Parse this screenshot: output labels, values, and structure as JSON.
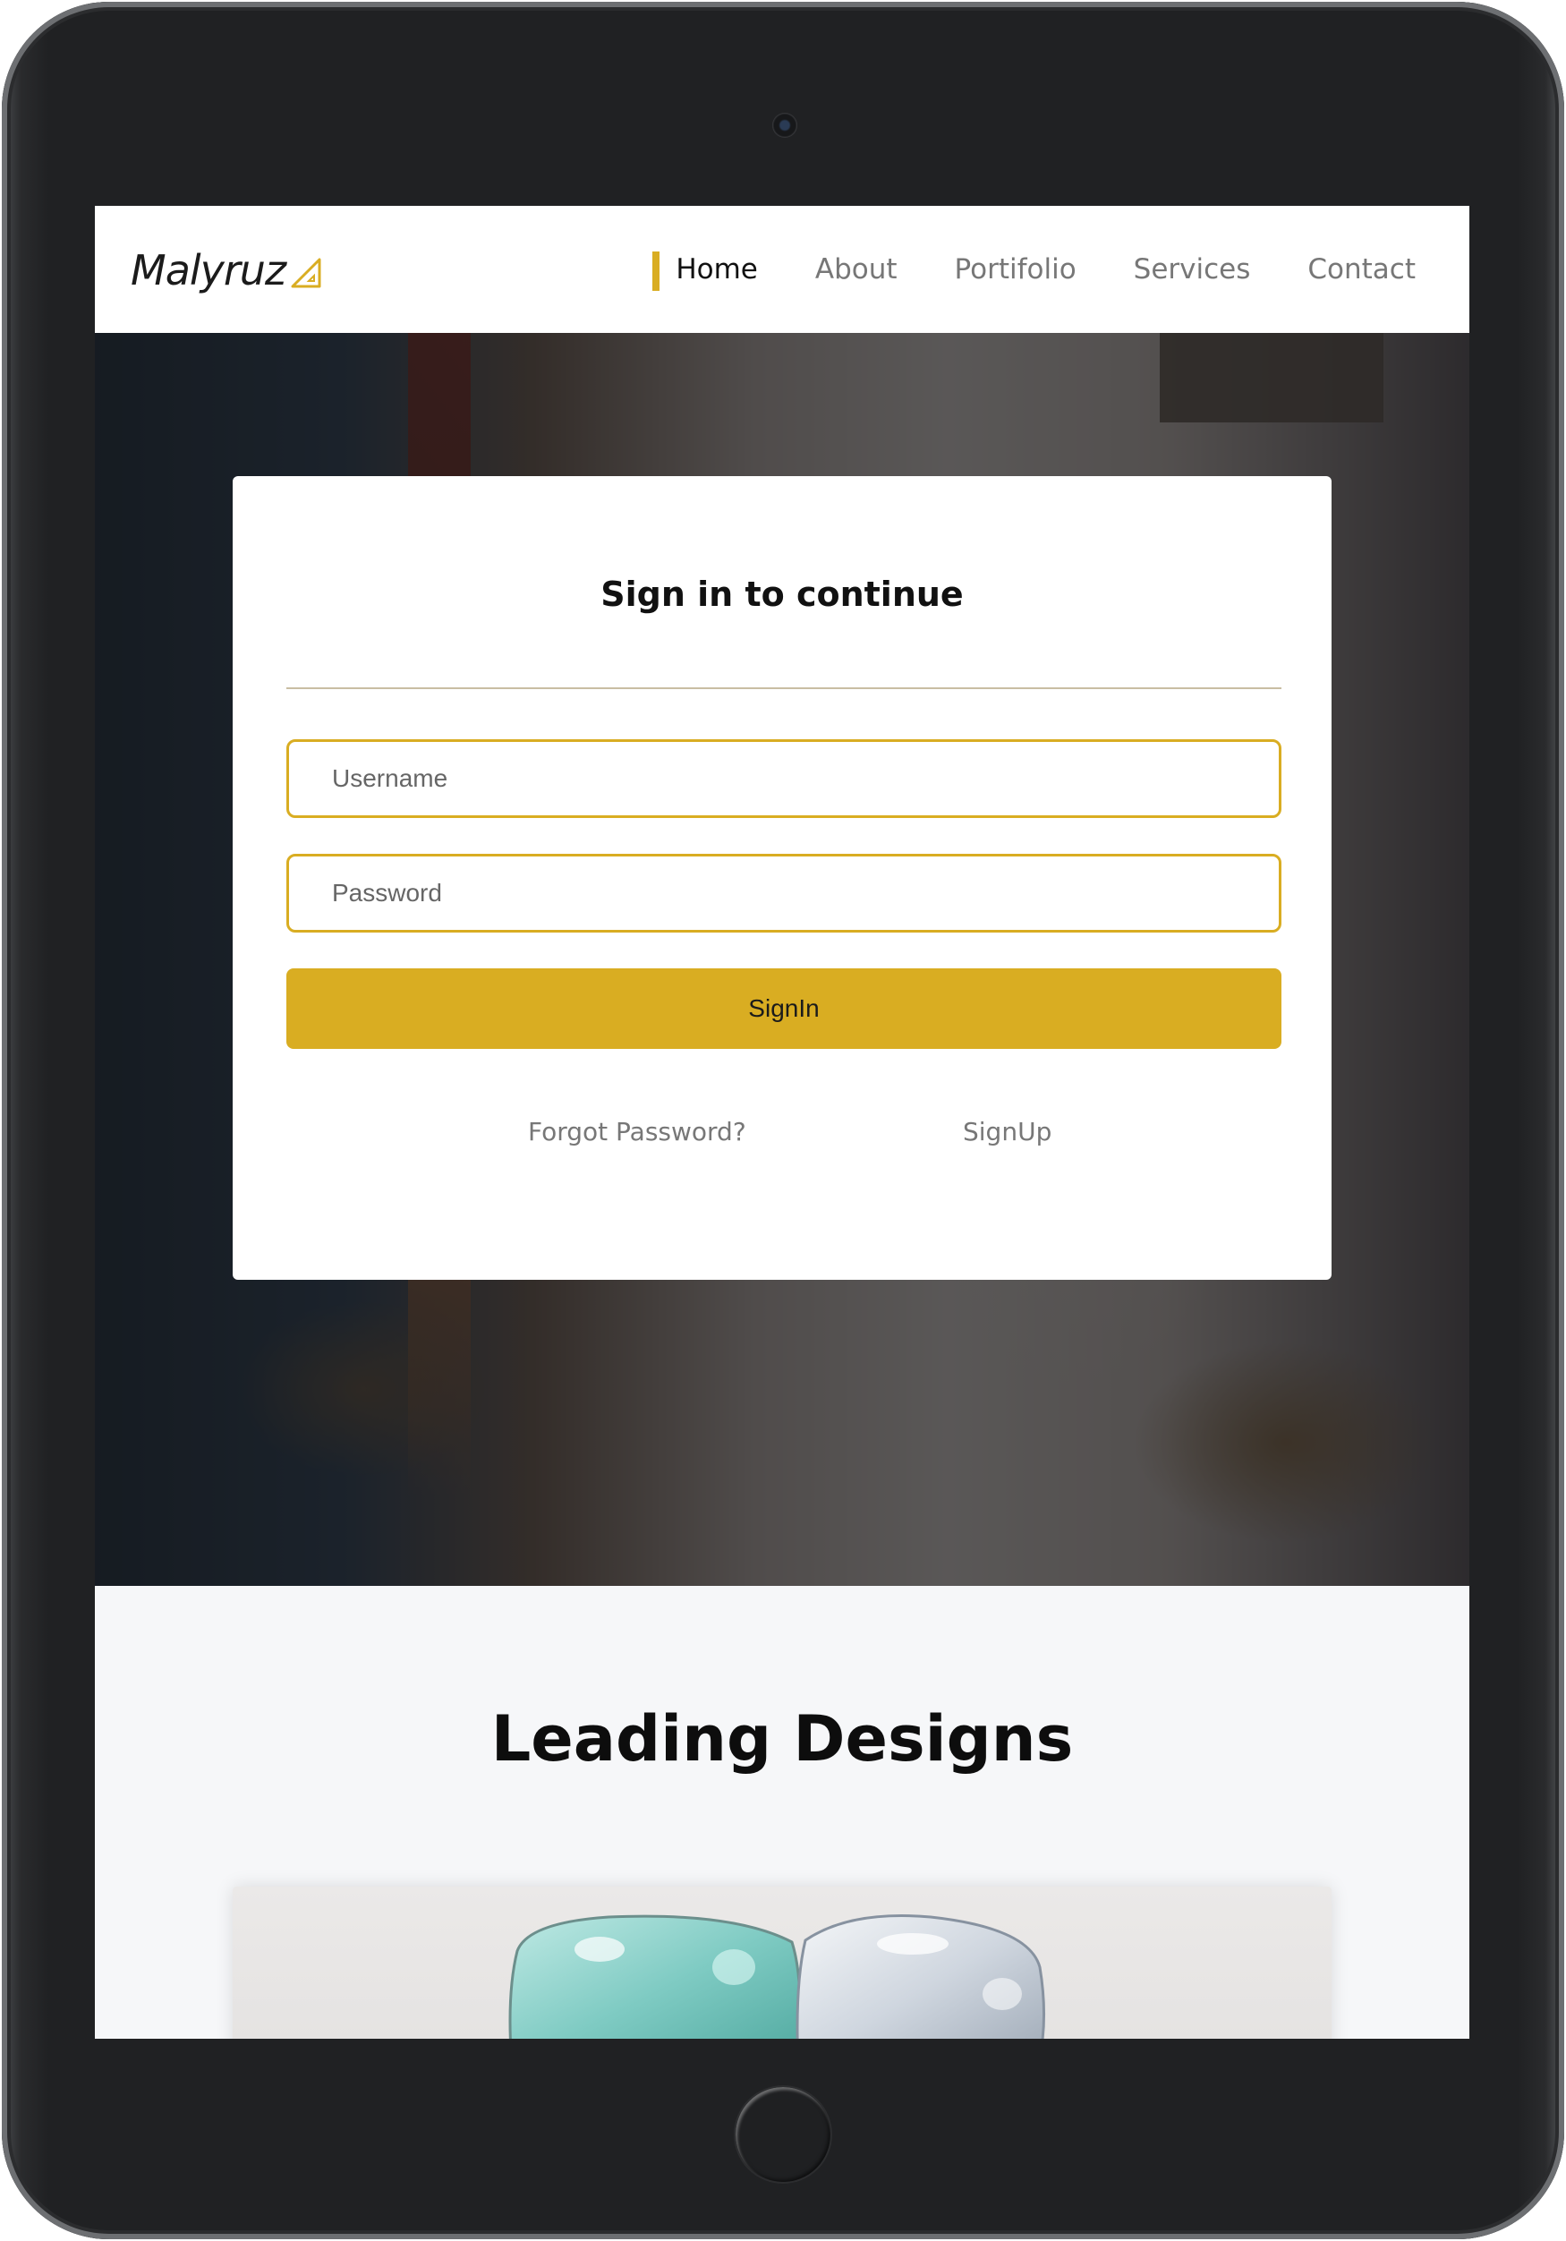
{
  "navbar": {
    "brand": "Malyruz",
    "brand_icon": "triangle-ruler-icon",
    "items": [
      {
        "label": "Home",
        "active": true
      },
      {
        "label": "About",
        "active": false
      },
      {
        "label": "Portifolio",
        "active": false
      },
      {
        "label": "Services",
        "active": false
      },
      {
        "label": "Contact",
        "active": false
      }
    ]
  },
  "signin": {
    "title": "Sign in to continue",
    "username_placeholder": "Username",
    "password_placeholder": "Password",
    "button_label": "SignIn",
    "forgot_label": "Forgot Password?",
    "signup_label": "SignUp"
  },
  "designs": {
    "title": "Leading Designs"
  },
  "colors": {
    "accent": "#d9ad22",
    "device_frame": "#202123",
    "section_bg": "#f6f7f9"
  }
}
